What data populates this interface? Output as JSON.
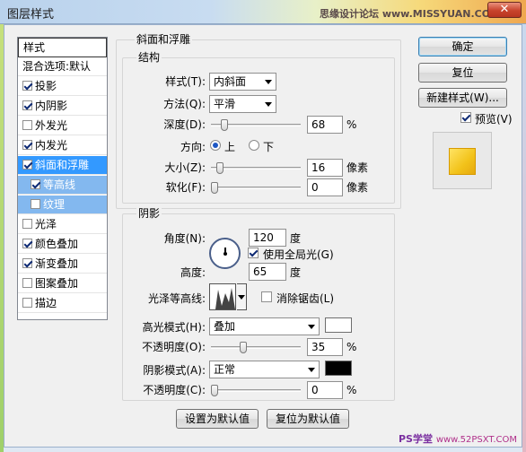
{
  "window": {
    "title": "图层样式",
    "watermark": "思缘设计论坛 www.MISSYUAN.COM",
    "close_symbol": "✕",
    "bottom_logo": "PS学堂",
    "bottom_url": "www.52PSXT.COM"
  },
  "styles_panel": {
    "header": "样式",
    "blending_options": "混合选项:默认",
    "items": [
      {
        "label": "投影",
        "checked": true
      },
      {
        "label": "内阴影",
        "checked": true
      },
      {
        "label": "外发光",
        "checked": false
      },
      {
        "label": "内发光",
        "checked": true
      },
      {
        "label": "斜面和浮雕",
        "checked": true
      },
      {
        "label": "等高线",
        "checked": true
      },
      {
        "label": "纹理",
        "checked": false
      },
      {
        "label": "光泽",
        "checked": false
      },
      {
        "label": "颜色叠加",
        "checked": true
      },
      {
        "label": "渐变叠加",
        "checked": true
      },
      {
        "label": "图案叠加",
        "checked": false
      },
      {
        "label": "描边",
        "checked": false
      }
    ]
  },
  "bevel": {
    "group_title": "斜面和浮雕",
    "structure_title": "结构",
    "style_label": "样式(T):",
    "style_value": "内斜面",
    "technique_label": "方法(Q):",
    "technique_value": "平滑",
    "depth_label": "深度(D):",
    "depth_value": "68",
    "depth_level": 0.12,
    "percent": "%",
    "direction_label": "方向:",
    "direction_up": "上",
    "direction_down": "下",
    "size_label": "大小(Z):",
    "size_value": "16",
    "size_level": 0.06,
    "soften_label": "软化(F):",
    "soften_value": "0",
    "soften_level": 0.0,
    "pixels": "像素"
  },
  "shading": {
    "title": "阴影",
    "angle_label": "角度(N):",
    "angle_value": "120",
    "degree": "度",
    "global_light_label": "使用全局光(G)",
    "altitude_label": "高度:",
    "altitude_value": "65",
    "gloss_contour_label": "光泽等高线:",
    "anti_aliased_label": "消除锯齿(L)",
    "highlight_mode_label": "高光模式(H):",
    "highlight_mode_value": "叠加",
    "highlight_color": "#ffffff",
    "highlight_opacity_label": "不透明度(O):",
    "highlight_opacity_value": "35",
    "highlight_opacity_level": 0.35,
    "shadow_mode_label": "阴影模式(A):",
    "shadow_mode_value": "正常",
    "shadow_color": "#000000",
    "shadow_opacity_label": "不透明度(C):",
    "shadow_opacity_value": "0",
    "shadow_opacity_level": 0.0
  },
  "footer": {
    "make_default": "设置为默认值",
    "reset_default": "复位为默认值"
  },
  "right_panel": {
    "ok": "确定",
    "reset": "复位",
    "new_style": "新建样式(W)...",
    "preview_label": "预览(V)"
  }
}
